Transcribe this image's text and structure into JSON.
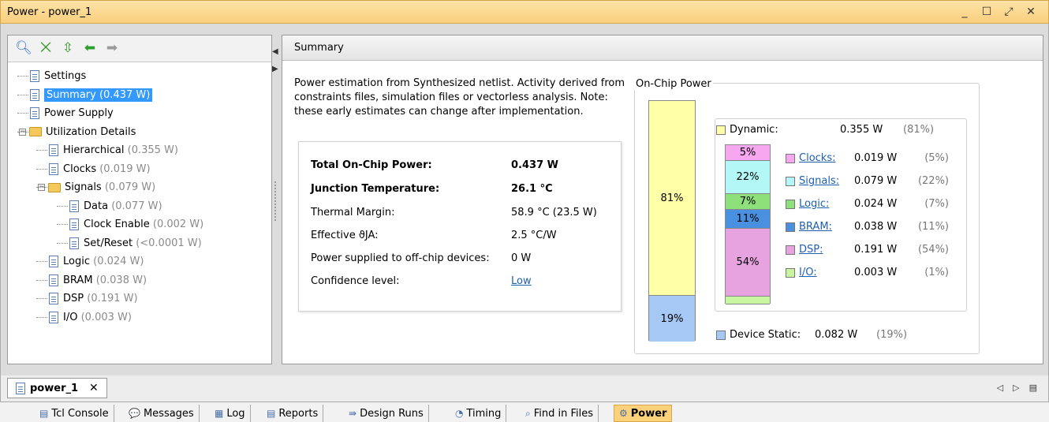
{
  "window": {
    "title": "Power - power_1",
    "controls": [
      "_",
      "☐",
      "⤢",
      "✕"
    ]
  },
  "tree": {
    "items": [
      {
        "label": "Settings",
        "value": "",
        "level": 1,
        "kind": "doc"
      },
      {
        "label": "Summary",
        "value": "(0.437 W)",
        "level": 1,
        "kind": "doc",
        "selected": true
      },
      {
        "label": "Power Supply",
        "value": "",
        "level": 1,
        "kind": "doc"
      },
      {
        "label": "Utilization Details",
        "value": "",
        "level": 1,
        "kind": "folder"
      },
      {
        "label": "Hierarchical",
        "value": "(0.355 W)",
        "level": 2,
        "kind": "doc"
      },
      {
        "label": "Clocks",
        "value": "(0.019 W)",
        "level": 2,
        "kind": "doc"
      },
      {
        "label": "Signals",
        "value": "(0.079 W)",
        "level": 2,
        "kind": "folder"
      },
      {
        "label": "Data",
        "value": "(0.077 W)",
        "level": 3,
        "kind": "doc"
      },
      {
        "label": "Clock Enable",
        "value": "(0.002 W)",
        "level": 3,
        "kind": "doc"
      },
      {
        "label": "Set/Reset",
        "value": "(<0.0001 W)",
        "level": 3,
        "kind": "doc"
      },
      {
        "label": "Logic",
        "value": "(0.024 W)",
        "level": 2,
        "kind": "doc"
      },
      {
        "label": "BRAM",
        "value": "(0.038 W)",
        "level": 2,
        "kind": "doc"
      },
      {
        "label": "DSP",
        "value": "(0.191 W)",
        "level": 2,
        "kind": "doc"
      },
      {
        "label": "I/O",
        "value": "(0.003 W)",
        "level": 2,
        "kind": "doc"
      }
    ]
  },
  "summary": {
    "header": "Summary",
    "description": "Power estimation from Synthesized netlist. Activity derived from constraints files, simulation files or vectorless analysis. Note: these early estimates can change after implementation.",
    "rows": [
      {
        "key": "Total On-Chip Power:",
        "value": "0.437 W",
        "bold": true
      },
      {
        "key": "Junction Temperature:",
        "value": "26.1 °C",
        "bold": true
      },
      {
        "key": "Thermal Margin:",
        "value": "58.9 °C (23.5 W)",
        "bold": false
      },
      {
        "key": "Effective ϑJA:",
        "value": "2.5 °C/W",
        "bold": false
      },
      {
        "key": "Power supplied to off-chip devices:",
        "value": "0 W",
        "bold": false
      },
      {
        "key": "Confidence level:",
        "value": "Low",
        "bold": false,
        "link": true
      }
    ]
  },
  "onchip": {
    "title": "On-Chip Power",
    "dynamic": {
      "label": "Dynamic:",
      "watts": "0.355 W",
      "pct": "(81%)",
      "bar_label": "81%",
      "color": "#ffffa8"
    },
    "static": {
      "label": "Device Static:",
      "watts": "0.082 W",
      "pct": "(19%)",
      "bar_label": "19%",
      "color": "#a6c8f5"
    },
    "components": [
      {
        "name": "Clocks:",
        "watts": "0.019 W",
        "pct": "(5%)",
        "bar_label": "5%",
        "color": "#f7a6f0"
      },
      {
        "name": "Signals:",
        "watts": "0.079 W",
        "pct": "(22%)",
        "bar_label": "22%",
        "color": "#b3f7f7"
      },
      {
        "name": "Logic:",
        "watts": "0.024 W",
        "pct": "(7%)",
        "bar_label": "7%",
        "color": "#8ee07a"
      },
      {
        "name": "BRAM:",
        "watts": "0.038 W",
        "pct": "(11%)",
        "bar_label": "11%",
        "color": "#4a90e0"
      },
      {
        "name": "DSP:",
        "watts": "0.191 W",
        "pct": "(54%)",
        "bar_label": "54%",
        "color": "#e6a3e0"
      },
      {
        "name": "I/O:",
        "watts": "0.003 W",
        "pct": "(1%)",
        "bar_label": "",
        "color": "#c8f5a0"
      }
    ]
  },
  "doc_tab": {
    "label": "power_1",
    "close": "✕"
  },
  "bottom_tabs": [
    {
      "label": "Tcl Console",
      "icon": "▤"
    },
    {
      "label": "Messages",
      "icon": "💬"
    },
    {
      "label": "Log",
      "icon": "▦"
    },
    {
      "label": "Reports",
      "icon": "▤"
    },
    {
      "label": "Design Runs",
      "icon": "⇛"
    },
    {
      "label": "Timing",
      "icon": "◔"
    },
    {
      "label": "Find in Files",
      "icon": "⌕"
    },
    {
      "label": "Power",
      "icon": "⚙",
      "active": true
    }
  ]
}
